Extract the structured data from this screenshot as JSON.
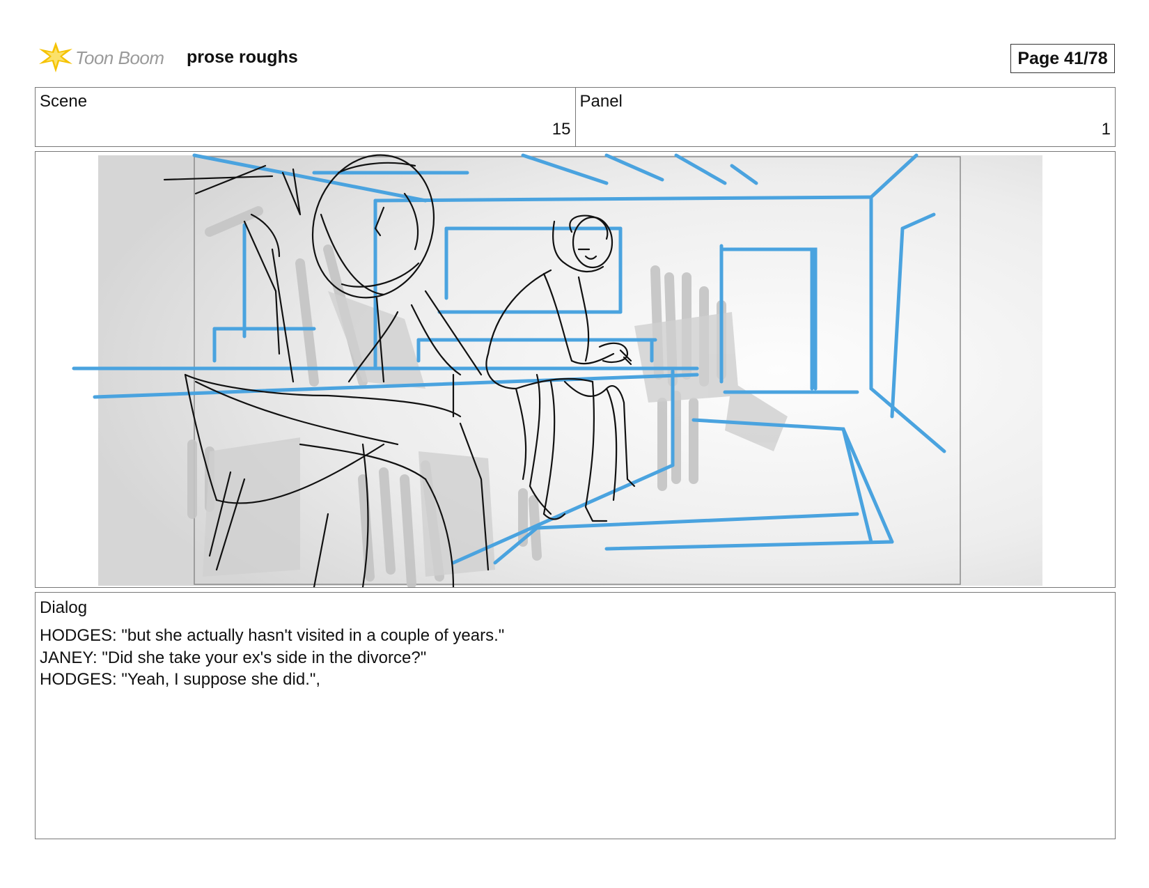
{
  "header": {
    "logo_text": "Toon Boom",
    "project_title": "prose roughs",
    "page_label": "Page 41/78"
  },
  "scene": {
    "label": "Scene",
    "value": "15"
  },
  "panel": {
    "label": "Panel",
    "value": "1"
  },
  "dialog": {
    "label": "Dialog",
    "lines": [
      "HODGES: \"but she actually hasn't visited in a couple of years.\"",
      "JANEY: \"Did she take your ex's side in the divorce?\"",
      "HODGES: \"Yeah, I suppose she did.\","
    ]
  },
  "colors": {
    "layout_lines": "#4aa3df",
    "ink": "#111111",
    "shading": "#bdbdbd",
    "logo_star": "#f5c200"
  }
}
